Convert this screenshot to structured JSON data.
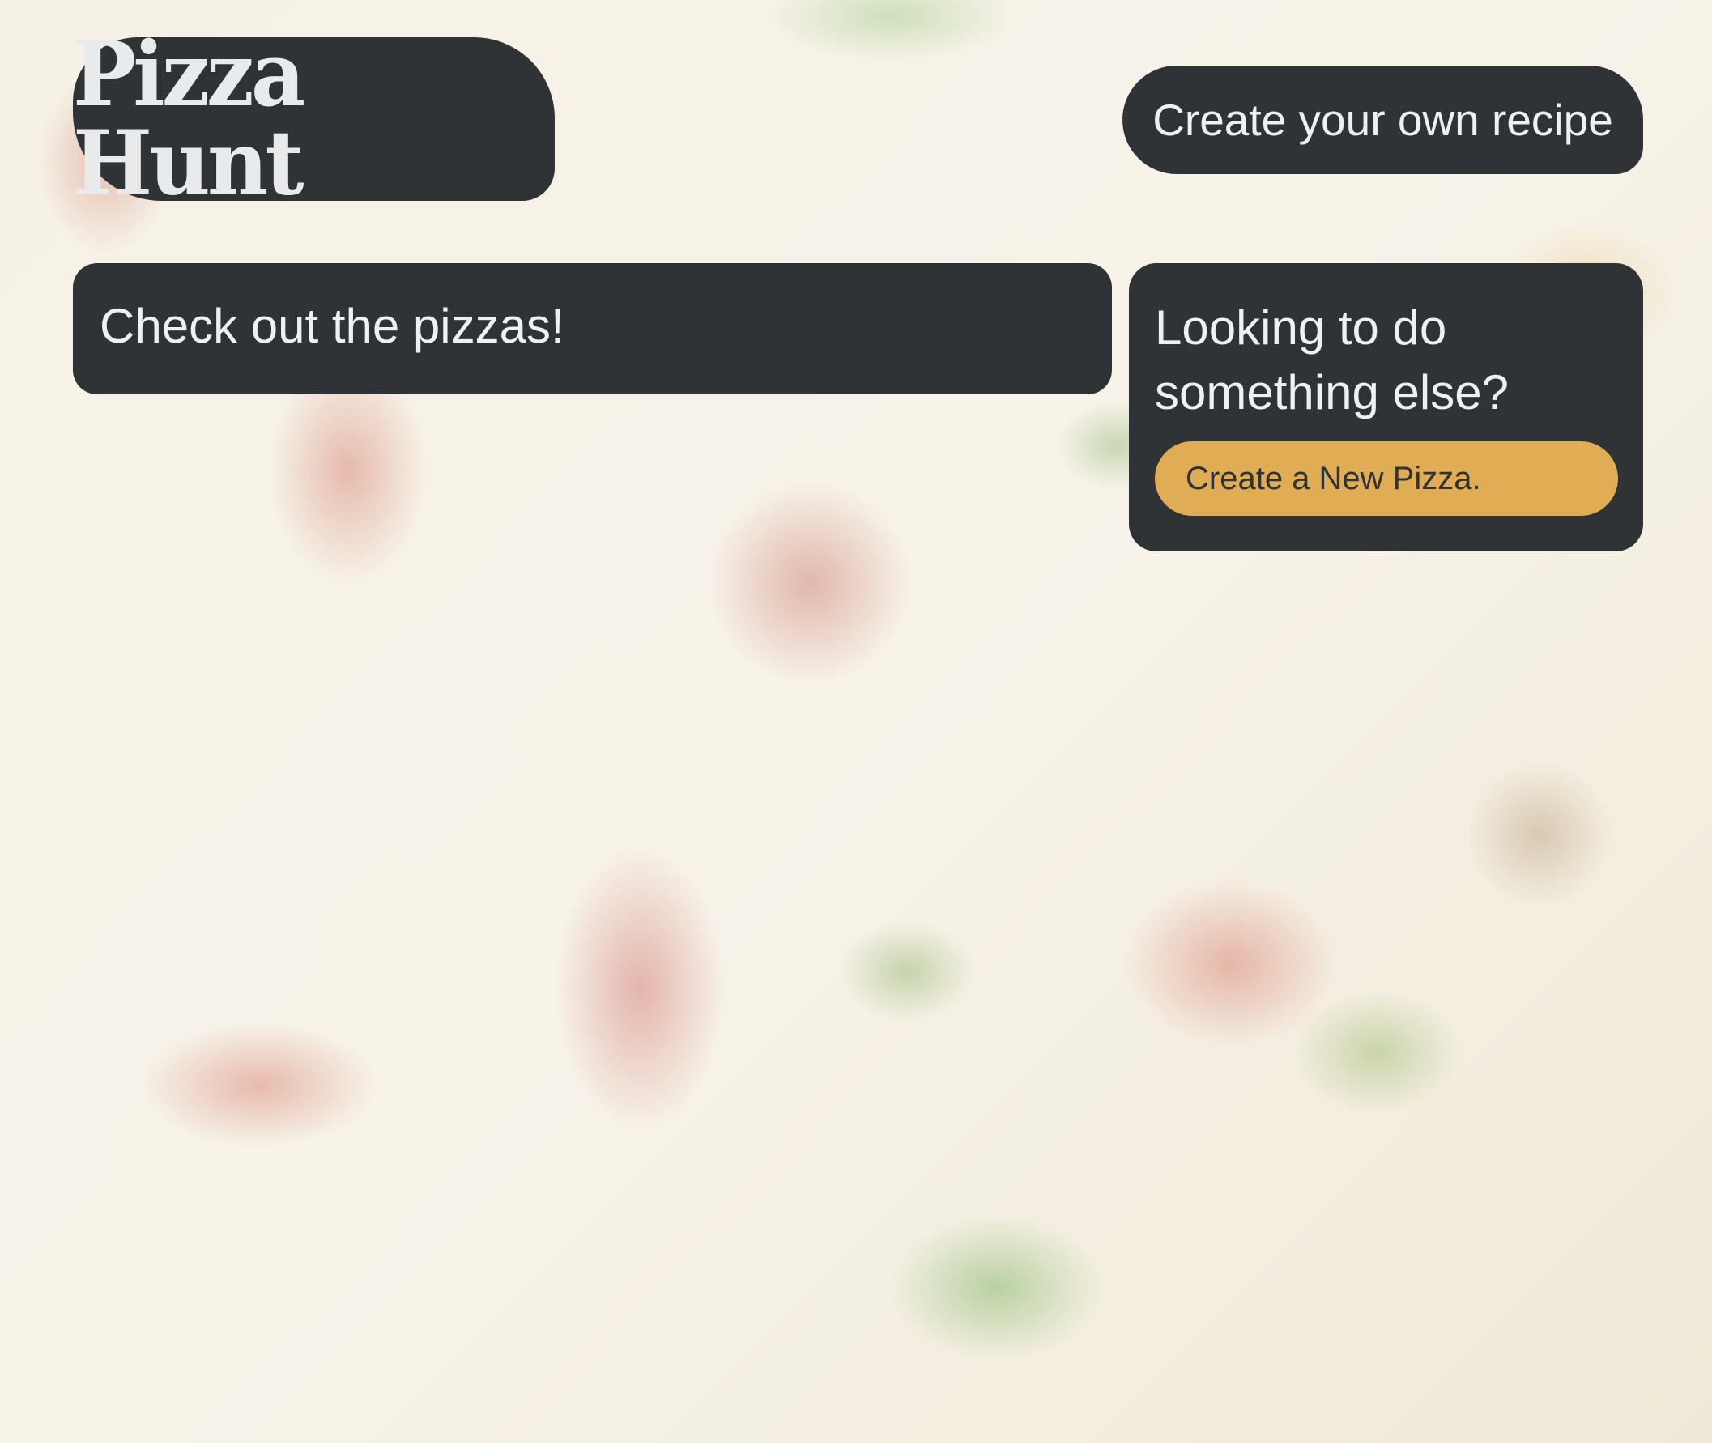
{
  "header": {
    "logo_text": "Pizza Hunt",
    "create_recipe_label": "Create your own recipe"
  },
  "main": {
    "pizzas_heading": "Check out the pizzas!"
  },
  "sidebar": {
    "heading": "Looking to do something else?",
    "new_pizza_label": "Create a New Pizza."
  },
  "colors": {
    "panel": "#2f3336",
    "panel_text": "#eef0f1",
    "accent_button": "#e0ad55"
  }
}
